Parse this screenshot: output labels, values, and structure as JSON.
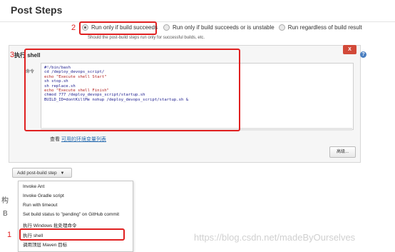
{
  "section": {
    "title": "Post Steps"
  },
  "post_steps": {
    "annotation_number": "2",
    "options": [
      {
        "label": "Run only if build succeeds",
        "selected": true
      },
      {
        "label": "Run only if build succeeds or is unstable",
        "selected": false
      },
      {
        "label": "Run regardless of build result",
        "selected": false
      }
    ],
    "hint": "Should the post-build steps run only for successful builds, etc."
  },
  "shell_step": {
    "annotation_number": "3",
    "title": "执行 shell",
    "delete_label": "X",
    "help_label": "?",
    "command_label": "命令",
    "code_lines": [
      {
        "text": "#!/bin/bash",
        "kind": "plain"
      },
      {
        "text": "cd /deploy_devops_script/",
        "kind": "plain"
      },
      {
        "text": "echo \"Execute shell Start\"",
        "kind": "str"
      },
      {
        "text": "sh stop.sh",
        "kind": "plain"
      },
      {
        "text": "sh replace.sh",
        "kind": "plain"
      },
      {
        "text": "echo \"Execute shell Finish\"",
        "kind": "str"
      },
      {
        "text": "chmod 777 /deploy_devops_script/startup.sh",
        "kind": "plain"
      },
      {
        "text": "BUILD_ID=dontKillMe nohup /deploy_devops_script/startup.sh &",
        "kind": "plain"
      }
    ],
    "env_prefix": "查看",
    "env_link": "可用的环境变量列表",
    "advanced_label": "高级..."
  },
  "add_step": {
    "label": "Add post-build step",
    "annotation_number": "1",
    "menu_items": [
      "Invoke Ant",
      "Invoke Gradle script",
      "Run with timeout",
      "Set build status to \"pending\" on GitHub commit",
      "执行 Windows 批处理命令",
      "执行 shell",
      "调用顶层 Maven 目标"
    ],
    "highlighted_index": 5
  },
  "left_fragments": {
    "first": "构",
    "second": "B"
  },
  "watermark": "https://blog.csdn.net/madeByOurselves",
  "colors": {
    "annotation_red": "#e02020",
    "delete_red": "#d24939",
    "link_blue": "#2a6db0",
    "help_blue": "#4a7fc1"
  }
}
